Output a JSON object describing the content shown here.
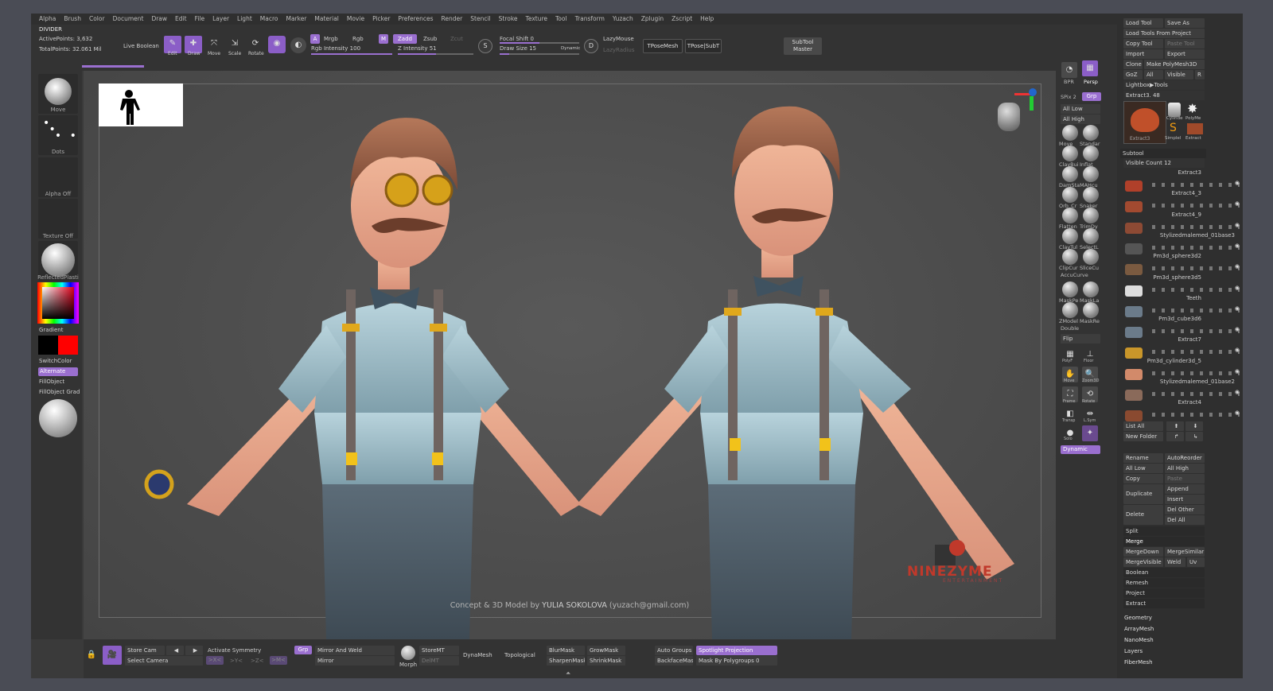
{
  "menu": [
    "Alpha",
    "Brush",
    "Color",
    "Document",
    "Draw",
    "Edit",
    "File",
    "Layer",
    "Light",
    "Macro",
    "Marker",
    "Material",
    "Movie",
    "Picker",
    "Preferences",
    "Render",
    "Stencil",
    "Stroke",
    "Texture",
    "Tool",
    "Transform",
    "Yuzach",
    "Zplugin",
    "Zscript",
    "Help"
  ],
  "info": {
    "divider": "DIVIDER",
    "active_points": "ActivePoints: 3,632",
    "total_points": "TotalPoints: 32.061 Mil"
  },
  "top": {
    "live_boolean": "Live Boolean",
    "edit": "Edit",
    "draw": "Draw",
    "move": "Move",
    "scale": "Scale",
    "rotate": "Rotate",
    "a": "A",
    "mrgb": "Mrgb",
    "rgb": "Rgb",
    "m": "M",
    "zadd": "Zadd",
    "zsub": "Zsub",
    "zcut": "Zcut",
    "rgb_intensity": "Rgb Intensity 100",
    "z_intensity": "Z Intensity 51",
    "focal_shift": "Focal Shift 0",
    "draw_size": "Draw Size 15",
    "dynamic": "Dynamic",
    "lazymouse": "LazyMouse",
    "lazyradius": "LazyRadius",
    "tposemesh": "TPoseMesh",
    "tposesubt": "TPose|SubT",
    "subtool_master_1": "SubTool",
    "subtool_master_2": "Master"
  },
  "left": {
    "move": "Move",
    "dots": "Dots",
    "alpha_off": "Alpha Off",
    "texture_off": "Texture Off",
    "material": "ReflectedPlasti",
    "gradient": "Gradient",
    "switchcolor": "SwitchColor",
    "alternate": "Alternate",
    "fillobject": "FillObject",
    "fillobject_grad": "FillObject Grad"
  },
  "canvas": {
    "credit_pre": "Concept & 3D Model by ",
    "credit_name": "YULIA SOKOLOVA",
    "credit_post": " (yuzach@gmail.com)",
    "logo": "NINEZYME",
    "logo_sub": "ENTERTAINMENT"
  },
  "right": {
    "bpr": "BPR",
    "persp": "Persp",
    "spix": "SPix 2",
    "grp": "Grp",
    "all_low": "All Low",
    "all_high": "All High",
    "brushes": [
      [
        "Move",
        "Standar"
      ],
      [
        "ClayBui",
        "Inflat"
      ],
      [
        "DamSta",
        "MAHcu"
      ],
      [
        "Orb_Cr",
        "Snaker"
      ],
      [
        "Flatten",
        "TrimDy"
      ],
      [
        "ClayTul",
        "SelectL"
      ],
      [
        "ClipCur",
        "SliceCu"
      ]
    ],
    "accucurve": "AccuCurve",
    "masks": [
      [
        "MaskPe",
        "MaskLa"
      ],
      [
        "ZModel",
        "MaskRe"
      ]
    ],
    "double": "Double",
    "flip": "Flip",
    "polyf": "PolyF",
    "floor": "Floor",
    "move": "Move",
    "zoom3d": "Zoom3D",
    "frame": "Frame",
    "rotate": "Rotate",
    "transp": "Transp",
    "lsym": "L.Sym",
    "solo": "Solo",
    "dynamic": "Dynamic"
  },
  "tray": {
    "load_tool": "Load Tool",
    "save_as": "Save As",
    "load_from_project": "Load Tools From Project",
    "copy_tool": "Copy Tool",
    "paste_tool": "Paste Tool",
    "import": "Import",
    "export": "Export",
    "clone": "Clone",
    "make_polymesh": "Make PolyMesh3D",
    "goz": "GoZ",
    "all": "All",
    "visible": "Visible",
    "r": "R",
    "lightbox_tools": "Lightbox▶Tools",
    "extract_48": "Extract3. 48",
    "tool_thumbs": [
      "Extract3",
      "Cylinde",
      "PolyMe",
      "Simplel",
      "Extract"
    ],
    "subtool": "Subtool",
    "visible_count": "Visible Count 12",
    "subtools": [
      "Extract3",
      "Extract4_3",
      "Extract4_9",
      "Stylizedmalemed_01base3",
      "Pm3d_sphere3d2",
      "Pm3d_sphere3d5",
      "Teeth",
      "Pm3d_cube3d6",
      "Extract7",
      "Pm3d_cylinder3d_5",
      "Stylizedmalemed_01base2",
      "Extract4"
    ],
    "list_all": "List All",
    "new_folder": "New Folder",
    "rename": "Rename",
    "autoreorder": "AutoReorder",
    "tr_all_low": "All Low",
    "tr_all_high": "All High",
    "copy": "Copy",
    "paste": "Paste",
    "duplicate": "Duplicate",
    "append": "Append",
    "insert": "Insert",
    "delete": "Delete",
    "del_other": "Del Other",
    "del_all": "Del All",
    "split": "Split",
    "merge": "Merge",
    "mergedown": "MergeDown",
    "mergesimilar": "MergeSimilar",
    "mergevisible": "MergeVisible",
    "weld": "Weld",
    "uv": "Uv",
    "boolean": "Boolean",
    "remesh": "Remesh",
    "project": "Project",
    "extract": "Extract",
    "geometry": "Geometry",
    "arraymesh": "ArrayMesh",
    "nanomesh": "NanoMesh",
    "layers": "Layers",
    "fibermesh": "FiberMesh"
  },
  "bottom": {
    "store_cam": "Store Cam",
    "select_camera": "Select Camera",
    "activate_symmetry": "Activate Symmetry",
    "grp": "Grp",
    "mirror_and_weld": "Mirror And Weld",
    "mirror": "Mirror",
    "morph": "Morph",
    "storemt": "StoreMT",
    "delmt": "DelMT",
    "dynamesh": "DynaMesh",
    "topological": "Topological",
    "blurmask": "BlurMask",
    "growmask": "GrowMask",
    "sharpenmask": "SharpenMask",
    "shrinkmask": "ShrinkMask",
    "auto_groups": "Auto Groups",
    "spotlight_projection": "Spotlight Projection",
    "backfacemask": "BackfaceMask",
    "mask_by_polygroups": "Mask By Polygroups 0",
    "x": ">X<",
    "y": ">Y<",
    "z": ">Z<",
    "m": ">M<"
  }
}
